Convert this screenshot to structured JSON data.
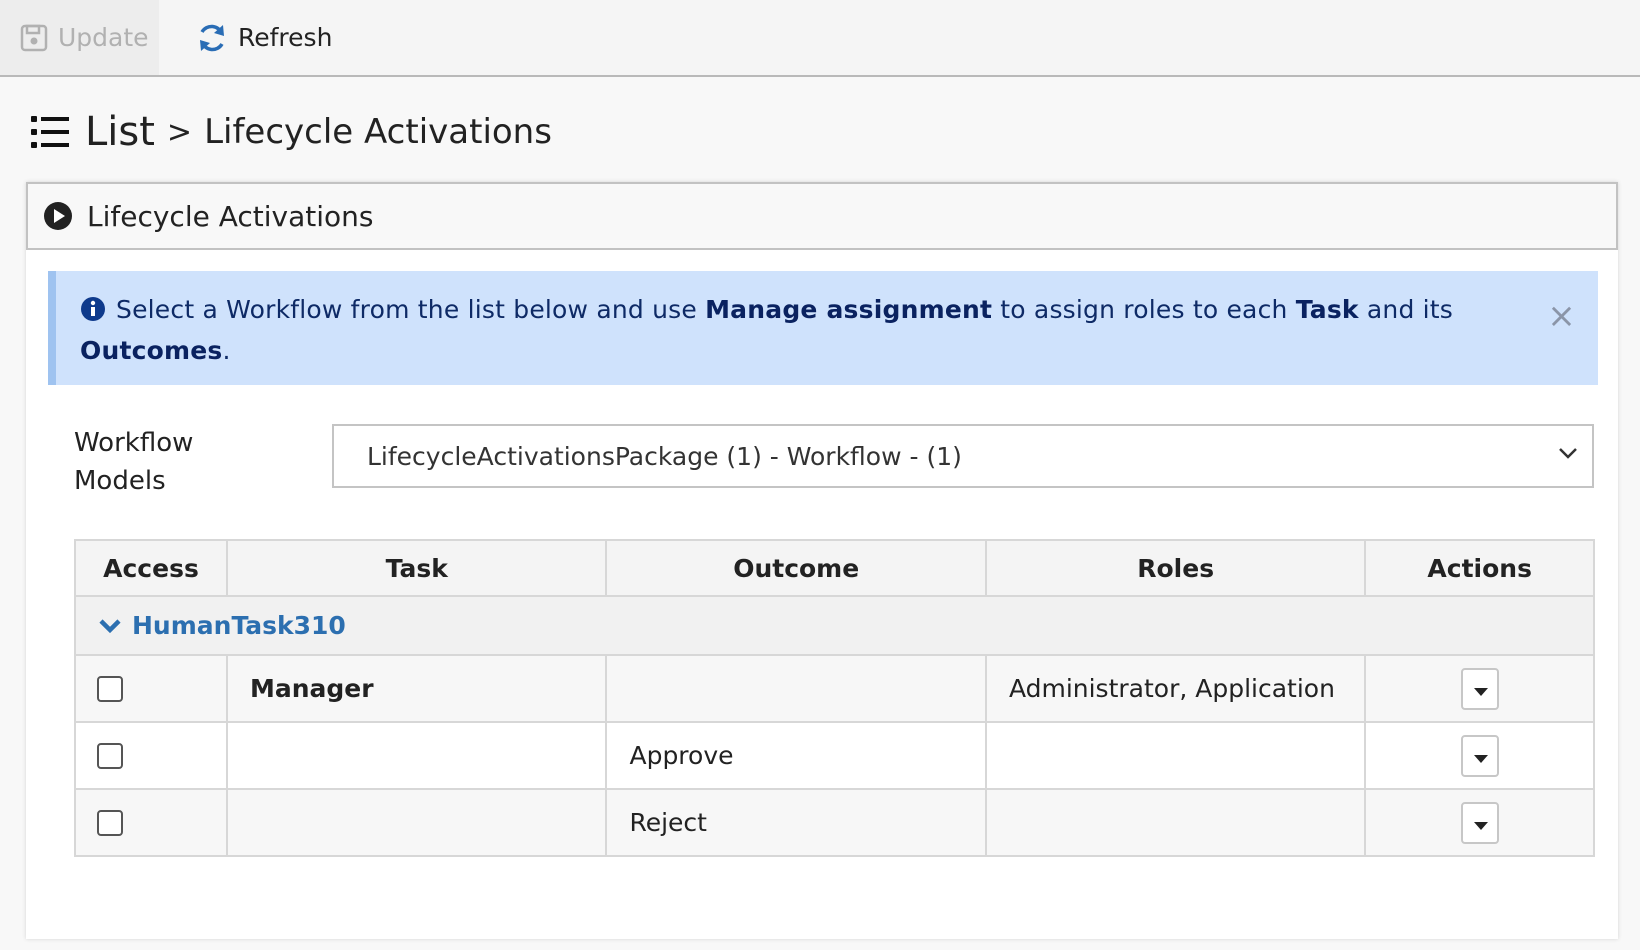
{
  "toolbar": {
    "update_label": "Update",
    "update_icon": "save-icon",
    "refresh_label": "Refresh",
    "refresh_icon": "refresh-icon"
  },
  "breadcrumb": {
    "icon": "list-icon",
    "root": "List",
    "separator": ">",
    "current": "Lifecycle Activations"
  },
  "panel": {
    "icon": "play-circle-icon",
    "title": "Lifecycle Activations"
  },
  "alert": {
    "icon": "info-icon",
    "text_1": "Select a Workflow from the list below and use ",
    "bold_1": "Manage assignment",
    "text_2": " to assign roles to each ",
    "bold_2": "Task",
    "text_3": " and its ",
    "bold_3": "Outcomes",
    "text_4": ".",
    "close": "×"
  },
  "workflow": {
    "label": "Workflow Models",
    "selected": "LifecycleActivationsPackage (1) - Workflow - (1)"
  },
  "table": {
    "columns": [
      "Access",
      "Task",
      "Outcome",
      "Roles",
      "Actions"
    ],
    "groups": [
      {
        "name": "HumanTask310",
        "rows": [
          {
            "access": false,
            "task": "Manager",
            "outcome": "",
            "roles": "Administrator, Application"
          },
          {
            "access": false,
            "task": "",
            "outcome": "Approve",
            "roles": ""
          },
          {
            "access": false,
            "task": "",
            "outcome": "Reject",
            "roles": ""
          }
        ]
      }
    ]
  },
  "colors": {
    "accent_link": "#2c6fb0",
    "alert_background": "#cfe2fc",
    "alert_text": "#0e2a66",
    "refresh_icon": "#2a6db5"
  }
}
